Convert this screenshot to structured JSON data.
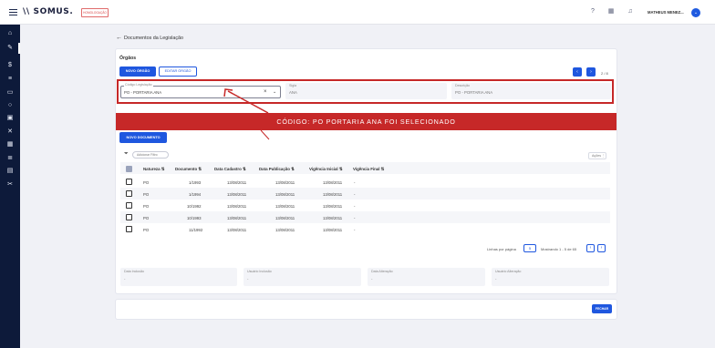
{
  "topbar": {
    "logo": "\\\\ SOMUS.",
    "env_badge": "HOMOLOGAÇÃO",
    "user_name": "MATHEUS MENEZ...",
    "user_toggle": "⌄"
  },
  "breadcrumb": {
    "title": "Documentos da Legislação"
  },
  "orgaos": {
    "section_title": "Órgãos",
    "new_button": "NOVO ÓRGÃO",
    "edit_button": "EDITAR ÓRGÃO",
    "pager_count": "2 / 8",
    "codigo_label": "Código Legislação",
    "codigo_value": "PO - PORTARIA ANA",
    "sigla_label": "Sigla",
    "sigla_value": "ANA",
    "descricao_label": "Descrição",
    "descricao_value": "PO - PORTARIA ANA"
  },
  "banner": {
    "text": "CÓDIGO: PO PORTARIA ANA FOI SELECIONADO"
  },
  "documentos": {
    "new_button": "NOVO DOCUMENTO",
    "filter_chip": "Adicionar Filtro",
    "acoes": "Ações",
    "columns": [
      "Natureza",
      "Documento",
      "Data Cadastro",
      "Data Publicação",
      "Vigência Inicial",
      "Vigência Final"
    ],
    "rows": [
      [
        "PO",
        "1/1993",
        "13/08/2011",
        "13/08/2011",
        "13/08/2011",
        "-"
      ],
      [
        "PO",
        "1/1994",
        "13/08/2011",
        "13/08/2011",
        "13/08/2011",
        "-"
      ],
      [
        "PO",
        "10/1992",
        "13/08/2011",
        "13/08/2011",
        "13/08/2011",
        "-"
      ],
      [
        "PO",
        "10/1993",
        "13/08/2011",
        "13/08/2011",
        "13/08/2011",
        "-"
      ],
      [
        "PO",
        "11/1992",
        "13/08/2011",
        "13/08/2011",
        "13/08/2011",
        "-"
      ]
    ],
    "rows_per_page_label": "Linhas por página",
    "rows_per_page": "5",
    "showing": "Mostrando 1 - 5 de 65"
  },
  "audit": {
    "data_inclusao_label": "Data Inclusão",
    "data_inclusao": "-",
    "usuario_inclusao_label": "Usuário Inclusão",
    "usuario_inclusao": "-",
    "data_alteracao_label": "Data Alteração",
    "data_alteracao": "-",
    "usuario_alteracao_label": "Usuário Alteração",
    "usuario_alteracao": "-"
  },
  "footer": {
    "close_button": "FECHAR"
  },
  "colors": {
    "primary": "#1f57df",
    "sidebar": "#0d1a3a",
    "highlight": "#c62828"
  }
}
